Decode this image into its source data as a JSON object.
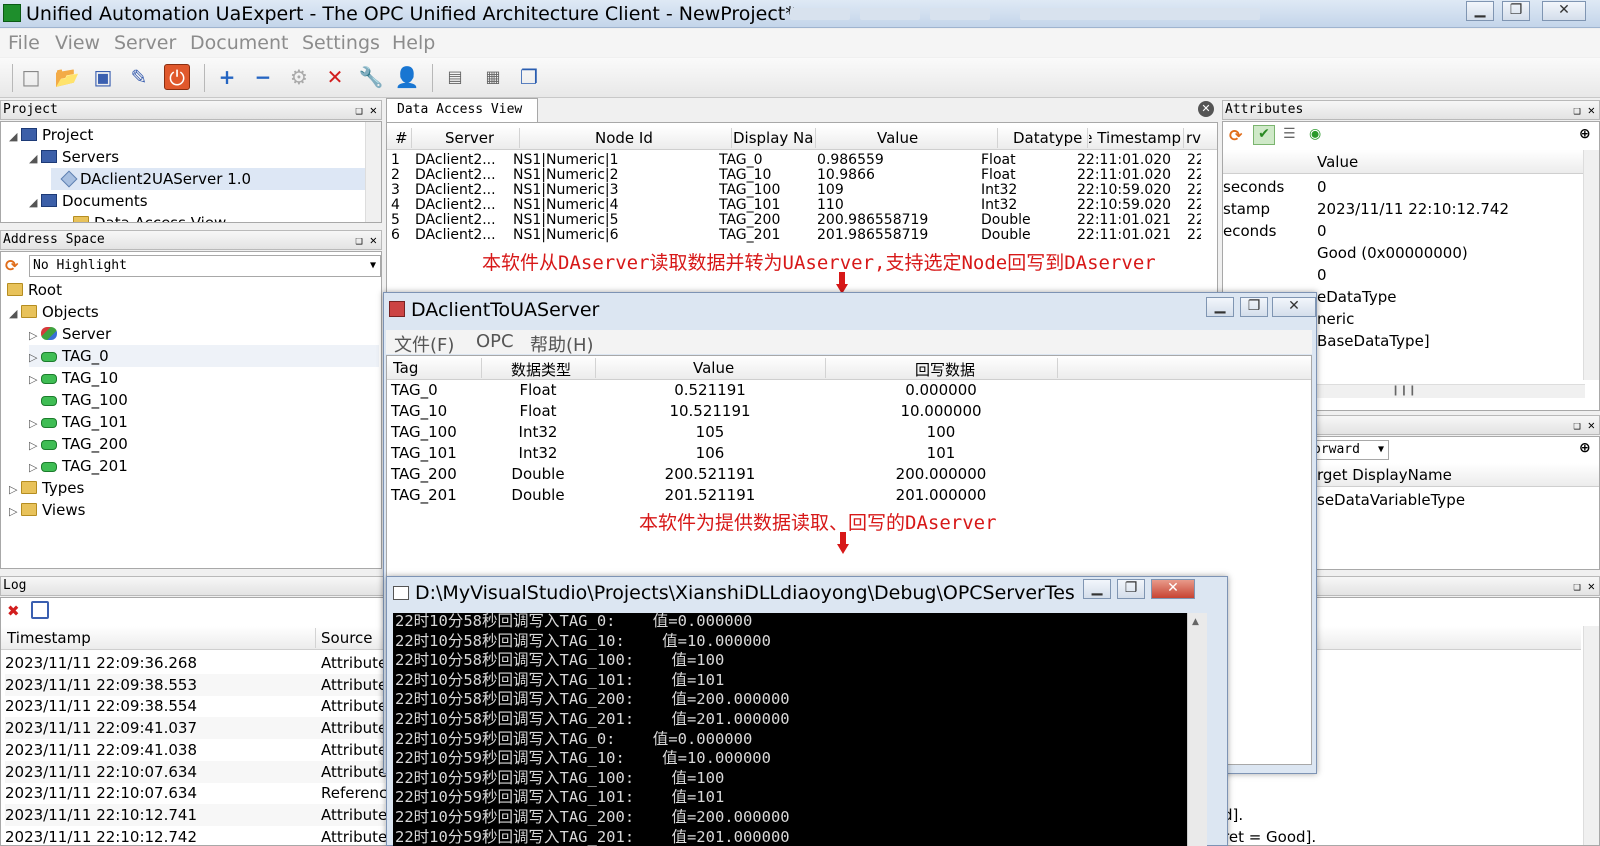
{
  "window": {
    "title": "Unified Automation UaExpert - The OPC Unified Architecture Client - NewProject*",
    "min": "▁",
    "max": "❐",
    "close": "✕"
  },
  "menu": [
    "File",
    "View",
    "Server",
    "Document",
    "Settings",
    "Help"
  ],
  "toolbar_icons": [
    "new-icon",
    "open-icon",
    "save-icon",
    "save-as-icon",
    "power-icon",
    "add-server-icon",
    "remove-server-icon",
    "connect-icon",
    "disconnect-icon",
    "settings-icon",
    "user-icon",
    "report-icon",
    "calendar-icon",
    "window-icon"
  ],
  "project": {
    "header": "Project",
    "items": [
      "Project",
      "Servers",
      "DAclient2UAServer 1.0",
      "Documents",
      "Data Access View"
    ]
  },
  "address_space": {
    "header": "Address Space",
    "highlight": "No Highlight",
    "items": [
      "Root",
      "Objects",
      "Server",
      "TAG_0",
      "TAG_10",
      "TAG_100",
      "TAG_101",
      "TAG_200",
      "TAG_201",
      "Types",
      "Views"
    ]
  },
  "dav": {
    "tab": "Data Access View",
    "columns": [
      "#",
      "Server",
      "Node Id",
      "Display Name",
      "Value",
      "Datatype",
      "Source Timestamp",
      "Serv"
    ],
    "rows": [
      [
        "1",
        "DAclient2...",
        "NS1|Numeric|1",
        "TAG_0",
        "0.986559",
        "Float",
        "22:11:01.020",
        "22"
      ],
      [
        "2",
        "DAclient2...",
        "NS1|Numeric|2",
        "TAG_10",
        "10.9866",
        "Float",
        "22:11:01.020",
        "22"
      ],
      [
        "3",
        "DAclient2...",
        "NS1|Numeric|3",
        "TAG_100",
        "109",
        "Int32",
        "22:10:59.020",
        "22"
      ],
      [
        "4",
        "DAclient2...",
        "NS1|Numeric|4",
        "TAG_101",
        "110",
        "Int32",
        "22:10:59.020",
        "22"
      ],
      [
        "5",
        "DAclient2...",
        "NS1|Numeric|5",
        "TAG_200",
        "200.986558719",
        "Double",
        "22:11:01.021",
        "22"
      ],
      [
        "6",
        "DAclient2...",
        "NS1|Numeric|6",
        "TAG_201",
        "201.986558719",
        "Double",
        "22:11:01.021",
        "22"
      ]
    ]
  },
  "annotation1": "本软件从DAserver读取数据并转为UAserver,支持选定Node回写到DAserver",
  "annotation2": "本软件为提供数据读取、回写的DAserver",
  "attributes": {
    "header": "Attributes",
    "value_col": "Value",
    "rows": [
      {
        "k": "seconds",
        "v": "0"
      },
      {
        "k": "stamp",
        "v": "2023/11/11 22:10:12.742"
      },
      {
        "k": "econds",
        "v": "0"
      },
      {
        "k": "",
        "v": "Good (0x00000000)"
      },
      {
        "k": "",
        "v": "0"
      },
      {
        "k": "",
        "v": "eDataType"
      },
      {
        "k": "",
        "v": "neric"
      },
      {
        "k": "",
        "v": "BaseDataType]"
      }
    ]
  },
  "references": {
    "browse": "orward",
    "col": "rget DisplayName",
    "row": "seDataVariableType"
  },
  "dlg": {
    "title": "DAclientToUAServer",
    "menu": [
      "文件(F)",
      "OPC",
      "帮助(H)"
    ],
    "columns": [
      "Tag",
      "数据类型",
      "Value",
      "回写数据"
    ],
    "rows": [
      [
        "TAG_0",
        "Float",
        "0.521191",
        "0.000000"
      ],
      [
        "TAG_10",
        "Float",
        "10.521191",
        "10.000000"
      ],
      [
        "TAG_100",
        "Int32",
        "105",
        "100"
      ],
      [
        "TAG_101",
        "Int32",
        "106",
        "101"
      ],
      [
        "TAG_200",
        "Double",
        "200.521191",
        "200.000000"
      ],
      [
        "TAG_201",
        "Double",
        "201.521191",
        "201.000000"
      ]
    ]
  },
  "console": {
    "title": "D:\\MyVisualStudio\\Projects\\XianshiDLLdiaoyong\\Debug\\OPCServerTes...",
    "lines": [
      "22时10分58秒回调写入TAG_0:    值=0.000000",
      "22时10分58秒回调写入TAG_10:    值=10.000000",
      "22时10分58秒回调写入TAG_100:    值=100",
      "22时10分58秒回调写入TAG_101:    值=101",
      "22时10分58秒回调写入TAG_200:    值=200.000000",
      "22时10分58秒回调写入TAG_201:    值=201.000000",
      "22时10分59秒回调写入TAG_0:    值=0.000000",
      "22时10分59秒回调写入TAG_10:    值=10.000000",
      "22时10分59秒回调写入TAG_100:    值=100",
      "22时10分59秒回调写入TAG_101:    值=101",
      "22时10分59秒回调写入TAG_200:    值=200.000000",
      "22时10分59秒回调写入TAG_201:    值=201.000000"
    ]
  },
  "log": {
    "header": "Log",
    "columns": [
      "Timestamp",
      "Source"
    ],
    "rows": [
      [
        "2023/11/11 22:09:36.268",
        "Attribute"
      ],
      [
        "2023/11/11 22:09:38.553",
        "Attribute"
      ],
      [
        "2023/11/11 22:09:38.554",
        "Attribute"
      ],
      [
        "2023/11/11 22:09:41.037",
        "Attribute"
      ],
      [
        "2023/11/11 22:09:41.038",
        "Attribute"
      ],
      [
        "2023/11/11 22:10:07.634",
        "Attribute"
      ],
      [
        "2023/11/11 22:10:07.634",
        "Reference"
      ],
      [
        "2023/11/11 22:10:12.741",
        "Attribute"
      ],
      [
        "2023/11/11 22:10:12.742",
        "Attribute"
      ]
    ],
    "right_fragments": [
      "d].",
      "ret = Good]."
    ]
  }
}
